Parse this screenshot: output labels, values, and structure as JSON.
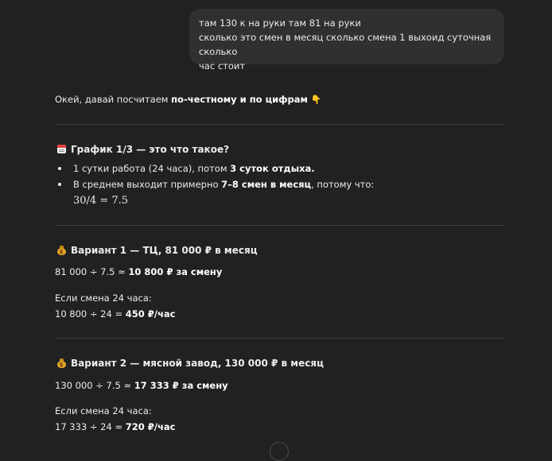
{
  "user_message": {
    "line1": "там 130 к на руки там 81 на руки",
    "line2": "сколько это смен в месяц сколько смена 1 выхоид суточная сколько",
    "line3": "час стоит"
  },
  "assistant": {
    "intro_prefix": "Окей, давай посчитаем ",
    "intro_bold": "по-честному и по цифрам",
    "intro_emoji": "👇",
    "section1": {
      "title": "График 1/3 — это что такое?",
      "bullet1_prefix": "1 сутки работа (24 часа), потом ",
      "bullet1_bold": "3 суток отдыха.",
      "bullet2_prefix": "В среднем выходит примерно ",
      "bullet2_bold": "7–8 смен в месяц",
      "bullet2_suffix": ", потому что:",
      "formula": "30/4 = 7.5"
    },
    "section2": {
      "title": "Вариант 1 — ТЦ, 81 000 ₽ в месяц",
      "calc1_prefix": "81 000 ÷ 7.5 ≈ ",
      "calc1_bold": "10 800 ₽ за смену",
      "note": "Если смена 24 часа:",
      "calc2_prefix": "10 800 ÷ 24 = ",
      "calc2_bold": "450 ₽/час"
    },
    "section3": {
      "title": "Вариант 2 — мясной завод, 130 000 ₽ в месяц",
      "calc1_prefix": "130 000 ÷ 7.5 ≈ ",
      "calc1_bold": "17 333 ₽ за смену",
      "note": "Если смена 24 часа:",
      "calc2_prefix": "17 333 ÷ 24 ≈ ",
      "calc2_bold": "720 ₽/час"
    }
  },
  "icons": {
    "calendar": "calendar-icon",
    "money_bag": "money-bag-icon",
    "pointing_down": "pointing-down-icon",
    "scroll_down": "scroll-down-button"
  }
}
